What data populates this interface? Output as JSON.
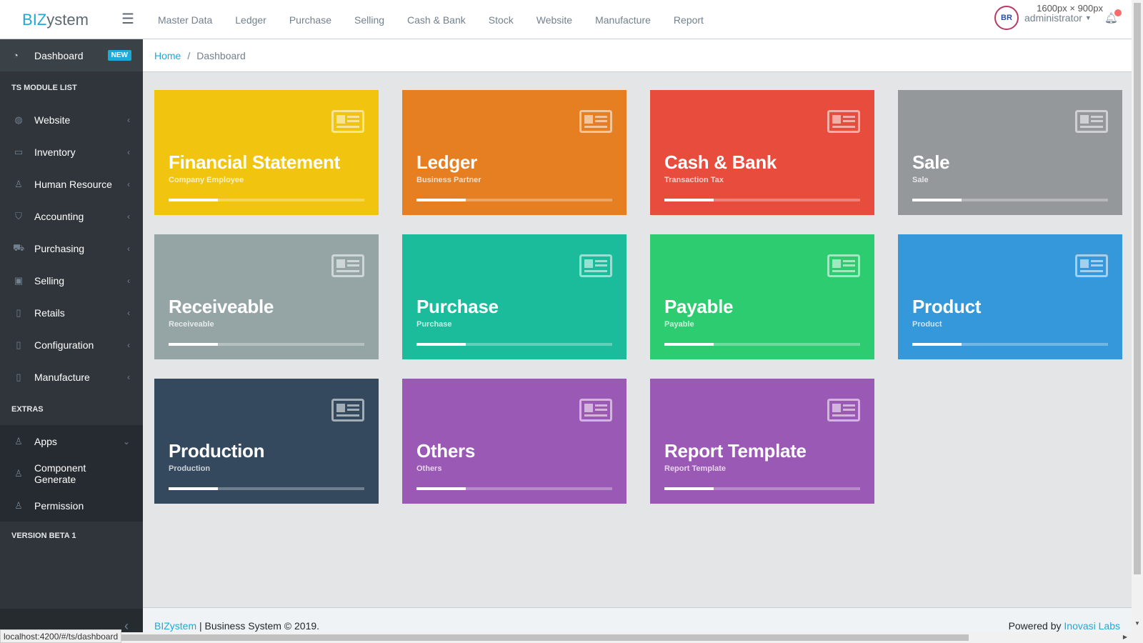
{
  "brand": {
    "prefix": "BIZ",
    "suffix": "ystem"
  },
  "topnav": [
    "Master Data",
    "Ledger",
    "Purchase",
    "Selling",
    "Cash & Bank",
    "Stock",
    "Website",
    "Manufacture",
    "Report"
  ],
  "user": {
    "avatar_text": "BR",
    "name": "administrator"
  },
  "screen_size_label": "1600px × 900px",
  "sidebar": {
    "dashboard": {
      "label": "Dashboard",
      "badge": "NEW"
    },
    "module_title": "TS MODULE LIST",
    "modules": [
      {
        "label": "Website",
        "icon": "globe-icon",
        "glyph": "◍"
      },
      {
        "label": "Inventory",
        "icon": "folder-icon",
        "glyph": "▭"
      },
      {
        "label": "Human Resource",
        "icon": "user-icon",
        "glyph": "♙"
      },
      {
        "label": "Accounting",
        "icon": "tag-icon",
        "glyph": "⛉"
      },
      {
        "label": "Purchasing",
        "icon": "cart-icon",
        "glyph": "⛟"
      },
      {
        "label": "Selling",
        "icon": "credit-card-icon",
        "glyph": "▣"
      },
      {
        "label": "Retails",
        "icon": "document-icon",
        "glyph": "▯"
      },
      {
        "label": "Configuration",
        "icon": "document-icon",
        "glyph": "▯"
      },
      {
        "label": "Manufacture",
        "icon": "document-icon",
        "glyph": "▯"
      }
    ],
    "extras_title": "EXTRAS",
    "extras": [
      {
        "label": "Apps",
        "icon": "user-icon",
        "glyph": "♙",
        "chevron": "⌄"
      },
      {
        "label": "Component Generate",
        "icon": "user-icon",
        "glyph": "♙",
        "chevron": ""
      },
      {
        "label": "Permission",
        "icon": "user-icon",
        "glyph": "♙",
        "chevron": ""
      }
    ],
    "version": "VERSION BETA 1"
  },
  "breadcrumb": {
    "home": "Home",
    "current": "Dashboard"
  },
  "cards": [
    {
      "title": "Financial Statement",
      "subtitle": "Company Employee",
      "color": "#f1c40f",
      "progress": 0.25
    },
    {
      "title": "Ledger",
      "subtitle": "Business Partner",
      "color": "#e67e22",
      "progress": 0.25
    },
    {
      "title": "Cash & Bank",
      "subtitle": "Transaction Tax",
      "color": "#e74c3c",
      "progress": 0.25
    },
    {
      "title": "Sale",
      "subtitle": "Sale",
      "color": "#95989a",
      "progress": 0.25
    },
    {
      "title": "Receiveable",
      "subtitle": "Receiveable",
      "color": "#95a5a6",
      "progress": 0.25
    },
    {
      "title": "Purchase",
      "subtitle": "Purchase",
      "color": "#1abc9c",
      "progress": 0.25
    },
    {
      "title": "Payable",
      "subtitle": "Payable",
      "color": "#2ecc71",
      "progress": 0.25
    },
    {
      "title": "Product",
      "subtitle": "Product",
      "color": "#3498db",
      "progress": 0.25
    },
    {
      "title": "Production",
      "subtitle": "Production",
      "color": "#34495e",
      "progress": 0.25
    },
    {
      "title": "Others",
      "subtitle": "Others",
      "color": "#9b59b6",
      "progress": 0.25
    },
    {
      "title": "Report Template",
      "subtitle": "Report Template",
      "color": "#9b59b6",
      "progress": 0.25
    }
  ],
  "footer": {
    "brand_link": "BIZystem",
    "copyright": " | Business System © 2019.",
    "powered_by": "Powered by ",
    "company_link": "Inovasi Labs"
  },
  "status_url": "localhost:4200/#/ts/dashboard"
}
